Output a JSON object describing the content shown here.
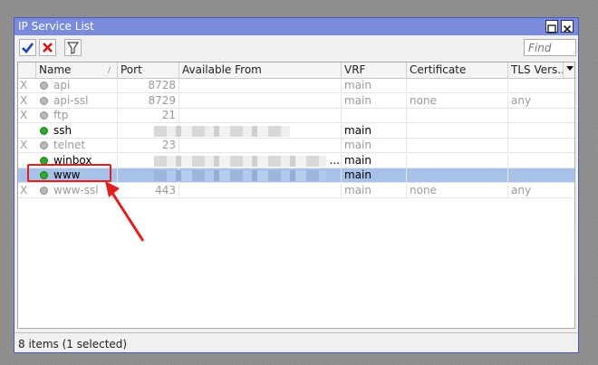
{
  "window": {
    "title": "IP Service List"
  },
  "toolbar": {
    "find_placeholder": "Find"
  },
  "columns": [
    "Name",
    "Port",
    "Available From",
    "VRF",
    "Certificate",
    "TLS Vers..."
  ],
  "rows": [
    {
      "flag": "X",
      "name": "api",
      "port": "8728",
      "vrf": "main",
      "certificate": "",
      "tls": "",
      "enabled": false
    },
    {
      "flag": "X",
      "name": "api-ssl",
      "port": "8729",
      "vrf": "main",
      "certificate": "none",
      "tls": "any",
      "enabled": false
    },
    {
      "flag": "X",
      "name": "ftp",
      "port": "21",
      "vrf": "",
      "certificate": "",
      "tls": "",
      "enabled": false
    },
    {
      "flag": "",
      "name": "ssh",
      "port": "",
      "vrf": "main",
      "certificate": "",
      "tls": "",
      "enabled": true
    },
    {
      "flag": "X",
      "name": "telnet",
      "port": "23",
      "vrf": "main",
      "certificate": "",
      "tls": "",
      "enabled": false
    },
    {
      "flag": "",
      "name": "winbox",
      "port": "",
      "available_from_suffix": "...",
      "vrf": "main",
      "certificate": "",
      "tls": "",
      "enabled": true
    },
    {
      "flag": "",
      "name": "www",
      "port": "",
      "vrf": "main",
      "certificate": "",
      "tls": "",
      "enabled": true,
      "selected": true
    },
    {
      "flag": "X",
      "name": "www-ssl",
      "port": "443",
      "vrf": "main",
      "certificate": "none",
      "tls": "any",
      "enabled": false
    }
  ],
  "status": "8 items (1 selected)",
  "colors": {
    "title_bar": "#7b8bdc",
    "selected_row": "#a7c1e9",
    "enabled_dot": "#2fa82f",
    "annotation": "#e02020"
  }
}
